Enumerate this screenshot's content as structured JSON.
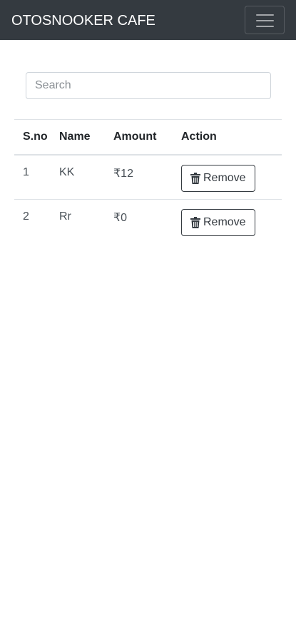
{
  "navbar": {
    "brand": "OTOSNOOKER CAFE",
    "toggler_icon": "hamburger-menu-icon"
  },
  "search": {
    "placeholder": "Search",
    "value": ""
  },
  "table": {
    "headers": [
      "S.no",
      "Name",
      "Amount",
      "Action"
    ],
    "rows": [
      {
        "sno": "1",
        "name": "KK",
        "amount": "₹12",
        "action_label": "Remove",
        "action_icon": "trash-icon"
      },
      {
        "sno": "2",
        "name": "Rr",
        "amount": "₹0",
        "action_label": "Remove",
        "action_icon": "trash-icon"
      }
    ]
  },
  "colors": {
    "navbar_bg": "#343a40",
    "navbar_text": "#ffffff",
    "border": "#dee2e6"
  }
}
